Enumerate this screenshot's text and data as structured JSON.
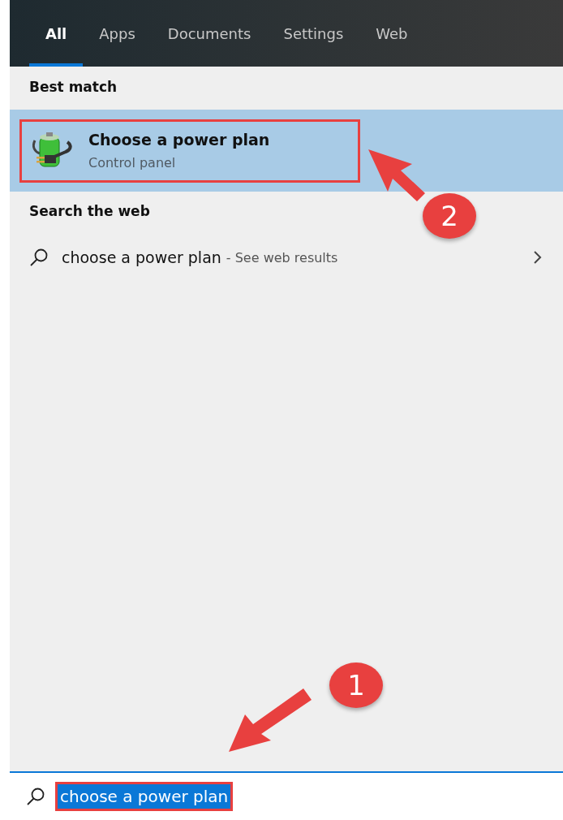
{
  "tabs": [
    {
      "label": "All",
      "selected": true
    },
    {
      "label": "Apps",
      "selected": false
    },
    {
      "label": "Documents",
      "selected": false
    },
    {
      "label": "Settings",
      "selected": false
    },
    {
      "label": "Web",
      "selected": false
    }
  ],
  "best_match": {
    "heading": "Best match",
    "title": "Choose a power plan",
    "subtitle": "Control panel",
    "selected": true
  },
  "search_the_web": {
    "heading": "Search the web",
    "query": "choose a power plan",
    "suffix": "- See web results"
  },
  "search_box": {
    "value": "choose a power plan",
    "selected": true
  },
  "callouts": [
    {
      "label": "2"
    },
    {
      "label": "1"
    }
  ]
}
